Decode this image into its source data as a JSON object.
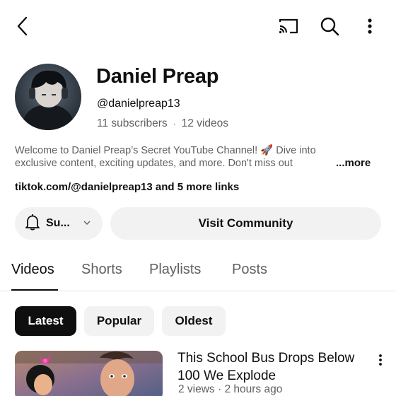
{
  "topbar": {
    "back_icon": "arrow-back-icon",
    "cast_icon": "cast-icon",
    "search_icon": "search-icon",
    "more_icon": "more-vertical-icon"
  },
  "channel": {
    "name": "Daniel Preap",
    "handle": "@danielpreap13",
    "subscribers": "11 subscribers",
    "separator": "·",
    "videos": "12 videos",
    "description_line1": "Welcome to Daniel Preap’s Secret YouTube Channel! 🚀 Dive into",
    "description_line2": "exclusive content, exciting updates, and more. Don't miss out",
    "more_label": "...more",
    "links": "tiktok.com/@danielpreap13 and 5 more links"
  },
  "actions": {
    "subscribe_label": "Su...",
    "community_label": "Visit Community"
  },
  "tabs": [
    {
      "label": "Videos",
      "active": true
    },
    {
      "label": "Shorts",
      "active": false
    },
    {
      "label": "Playlists",
      "active": false
    },
    {
      "label": "Posts",
      "active": false
    }
  ],
  "sort_chips": [
    {
      "label": "Latest",
      "selected": true
    },
    {
      "label": "Popular",
      "selected": false
    },
    {
      "label": "Oldest",
      "selected": false
    }
  ],
  "video": {
    "title": "This School Bus Drops Below 100 We Explode",
    "meta": "2 views · 2 hours ago"
  },
  "colors": {
    "text_primary": "#0f0f0f",
    "text_secondary": "#606060",
    "chip_background": "#f2f2f2",
    "selected_chip": "#0f0f0f"
  }
}
